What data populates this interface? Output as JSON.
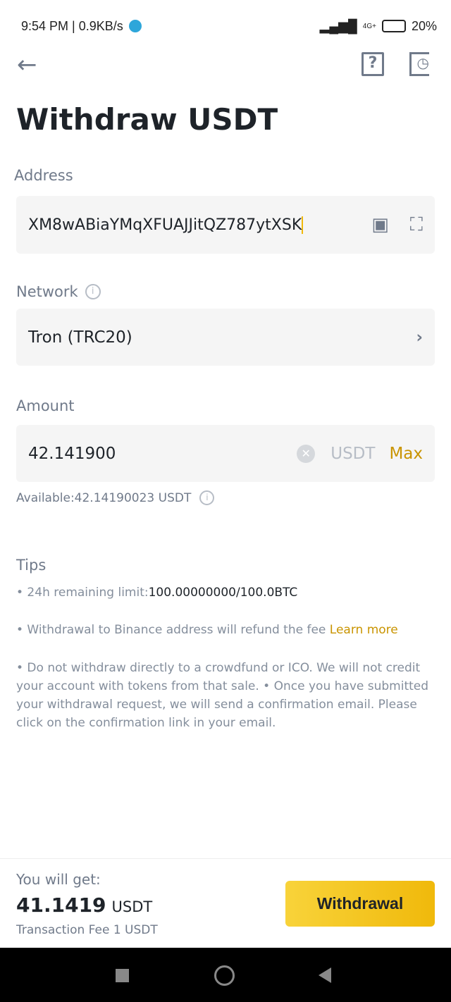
{
  "status_bar": {
    "time": "9:54 PM | 0.9KB/s",
    "network": "4G+",
    "battery": "20%"
  },
  "header": {
    "title": "Withdraw USDT",
    "icons": [
      "back-arrow-icon",
      "help-book-icon",
      "history-icon"
    ]
  },
  "address": {
    "label": "Address",
    "value": "XM8wABiaYMqXFUAJJitQZ787ytXSK"
  },
  "network": {
    "label": "Network",
    "value": "Tron (TRC20)"
  },
  "amount": {
    "label": "Amount",
    "value": "42.141900",
    "unit": "USDT",
    "max": "Max",
    "available": "Available:42.14190023 USDT"
  },
  "tips": {
    "title": "Tips",
    "limit_label": "• 24h remaining limit:",
    "limit_value": "100.00000000/100.0BTC",
    "refund": "• Withdrawal to Binance address will refund the fee ",
    "learn_more": "Learn more",
    "notice": "• Do not withdraw directly to a crowdfund or ICO. We will not credit your account with tokens from that sale. • Once you have submitted your withdrawal request, we will send a confirmation email. Please click on the confirmation link in your email."
  },
  "footer": {
    "you_get_label": "You will get:",
    "amount": "41.1419",
    "unit": "USDT",
    "fee": "Transaction Fee 1 USDT",
    "button": "Withdrawal"
  },
  "colors": {
    "accent": "#f0b90b",
    "link": "#c99400"
  }
}
